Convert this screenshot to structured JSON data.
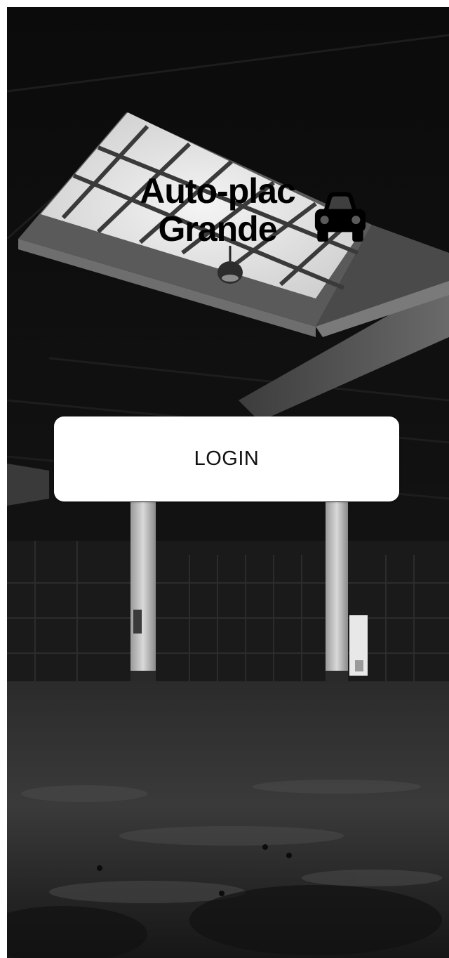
{
  "app": {
    "title_line1": "Auto-plac",
    "title_line2": "Grande",
    "logo_icon": "car-icon"
  },
  "actions": {
    "login_label": "LOGIN"
  },
  "background": {
    "description_icon": "warehouse-photo",
    "tone": "grayscale"
  }
}
